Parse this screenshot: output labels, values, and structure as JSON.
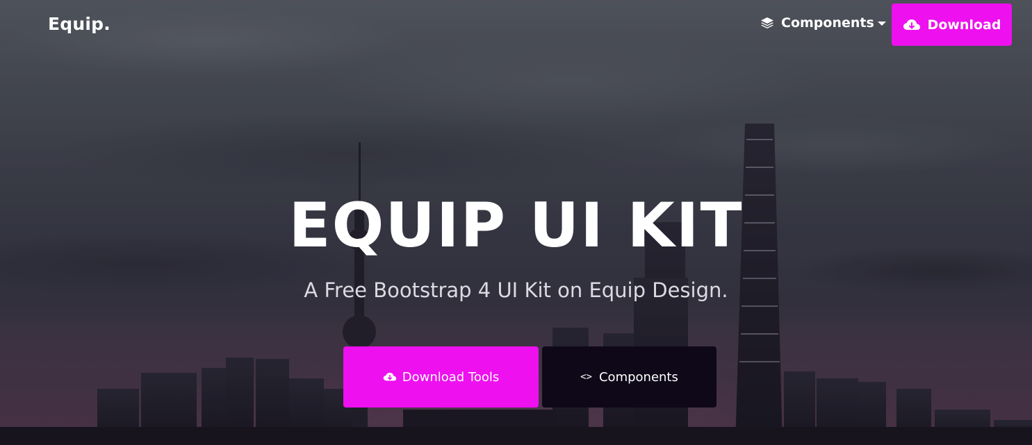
{
  "navbar": {
    "brand": "Equip.",
    "components_label": "Components",
    "download_label": "Download"
  },
  "hero": {
    "title": "EQUIP UI KIT",
    "subtitle": "A Free Bootstrap 4 UI Kit on Equip Design.",
    "primary_button": "Download Tools",
    "secondary_button": "Components"
  },
  "colors": {
    "accent": "#ee10ee",
    "dark_button": "#0e0818",
    "text": "#ffffff"
  },
  "icons": {
    "layers": "layers-icon",
    "cloud_download": "cloud-download-icon",
    "code": "code-icon",
    "caret": "caret-down-icon"
  }
}
